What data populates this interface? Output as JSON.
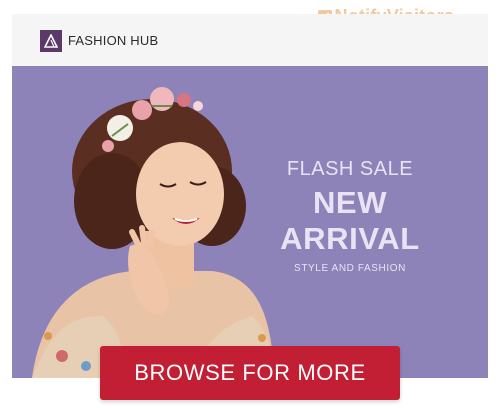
{
  "watermark": {
    "text": "NotifyVisitors",
    "icon": "notify-visitors-logo-icon"
  },
  "header": {
    "logo_icon": "triangle-logo-icon",
    "brand": "FASHION HUB"
  },
  "banner": {
    "image": "woman-with-flower-crown-photo",
    "background": "#8d83b9",
    "headline_small": "FLASH SALE",
    "headline_large": "NEW ARRIVAL",
    "tagline": "STYLE AND FASHION"
  },
  "cta": {
    "label": "BROWSE FOR MORE",
    "color": "#c21f34"
  }
}
